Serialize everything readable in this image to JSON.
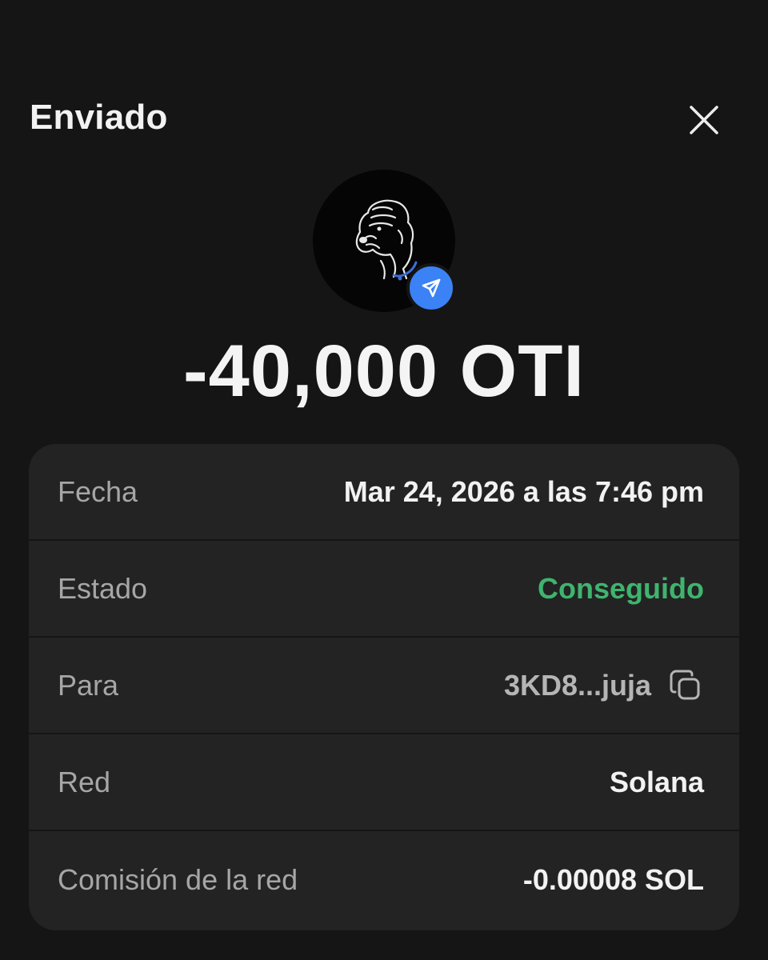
{
  "header": {
    "title": "Enviado",
    "close_icon": "close-icon"
  },
  "token": {
    "avatar_icon": "dog-logo",
    "badge_icon": "send-arrow-icon",
    "badge_color": "#3b82f6"
  },
  "amount": "-40,000 OTI",
  "details": {
    "fecha": {
      "label": "Fecha",
      "value": "Mar 24, 2026 a las 7:46 pm"
    },
    "estado": {
      "label": "Estado",
      "value": "Conseguido",
      "color": "#3fb46e"
    },
    "para": {
      "label": "Para",
      "value": "3KD8...juja",
      "copy_icon": "copy-icon"
    },
    "red": {
      "label": "Red",
      "value": "Solana"
    },
    "comision": {
      "label": "Comisión de la red",
      "value": "-0.00008 SOL"
    }
  }
}
